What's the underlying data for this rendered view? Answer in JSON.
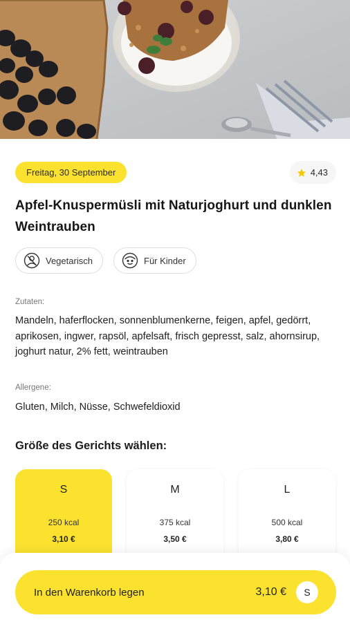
{
  "hero": {
    "image_alt": "muesli-bowl-with-grapes-photo"
  },
  "meal": {
    "date": "Freitag, 30 September",
    "rating": "4,43",
    "title": "Apfel-Knuspermüsli mit Naturjoghurt und dunklen Weintrauben",
    "tags": [
      {
        "label": "Vegetarisch",
        "icon": "vegetarian-person-icon"
      },
      {
        "label": "Für Kinder",
        "icon": "kid-face-icon"
      }
    ]
  },
  "ingredients": {
    "label": "Zutaten:",
    "text": "Mandeln, haferflocken, sonnenblumenkerne, feigen, apfel, gedörrt, aprikosen, ingwer, rapsöl, apfelsaft, frisch gepresst, salz, ahornsirup, joghurt natur, 2% fett, weintrauben"
  },
  "allergens": {
    "label": "Allergene:",
    "text": "Gluten, Milch, Nüsse, Schwefeldioxid"
  },
  "sizes": {
    "heading": "Größe des Gerichts wählen:",
    "selected": "S",
    "options": [
      {
        "size": "S",
        "kcal": "250 kcal",
        "price": "3,10 €"
      },
      {
        "size": "M",
        "kcal": "375 kcal",
        "price": "3,50 €"
      },
      {
        "size": "L",
        "kcal": "500 kcal",
        "price": "3,80 €"
      }
    ]
  },
  "cart": {
    "label": "In den Warenkorb legen",
    "price": "3,10 €",
    "size": "S"
  },
  "colors": {
    "accent": "#fbe22f",
    "text": "#1c1c1c",
    "muted": "#777777"
  }
}
